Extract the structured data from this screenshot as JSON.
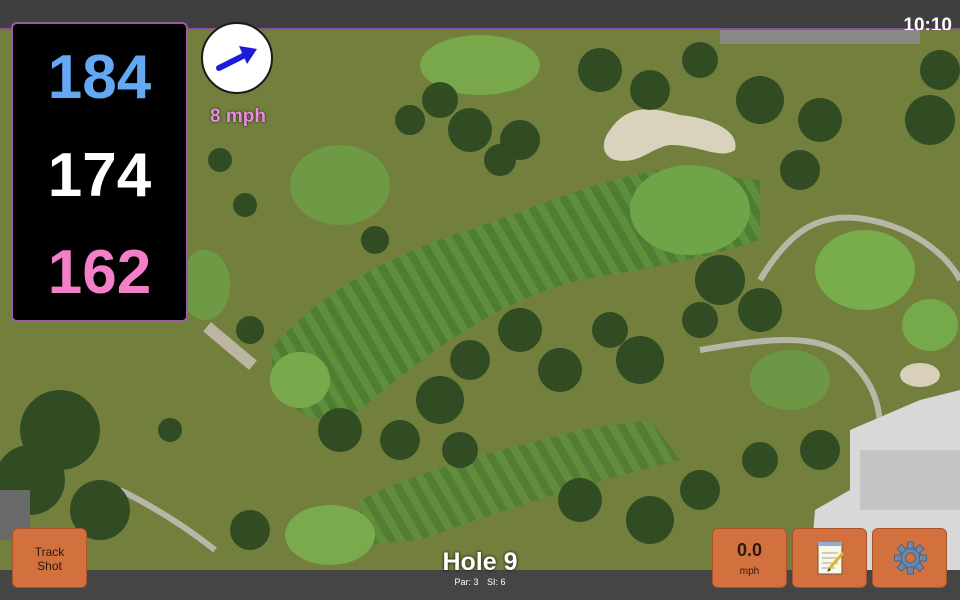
{
  "status": {
    "time": "10:10"
  },
  "distances": {
    "back": "184",
    "middle": "174",
    "front": "162"
  },
  "wind": {
    "speed": "8 mph",
    "direction_icon": "wind-arrow-icon"
  },
  "controls": {
    "track_shot": {
      "line1": "Track",
      "line2": "Shot"
    },
    "speed": {
      "value": "0.0",
      "unit": "mph"
    },
    "notes_icon": "notepad-icon",
    "settings_icon": "gear-icon"
  },
  "hole": {
    "title": "Hole 9",
    "par": "Par: 3",
    "si": "SI: 6"
  },
  "colors": {
    "back": "#62a8f2",
    "middle": "#ffffff",
    "front": "#f27fc7",
    "button": "#d2703e",
    "accent": "#8e4ea0"
  }
}
